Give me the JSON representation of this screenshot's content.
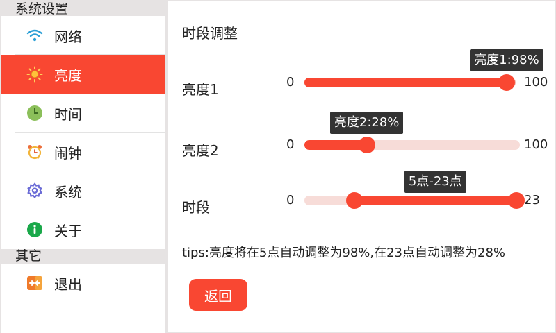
{
  "sidebar": {
    "section_system": "系统设置",
    "section_other": "其它",
    "items": [
      {
        "label": "网络",
        "icon": "wifi-icon"
      },
      {
        "label": "亮度",
        "icon": "sun-icon",
        "active": true
      },
      {
        "label": "时间",
        "icon": "clock-icon"
      },
      {
        "label": "闹钟",
        "icon": "alarm-clock-icon"
      },
      {
        "label": "系统",
        "icon": "gear-icon"
      },
      {
        "label": "关于",
        "icon": "info-icon"
      }
    ],
    "other_items": [
      {
        "label": "退出",
        "icon": "exit-icon"
      }
    ]
  },
  "main": {
    "title": "时段调整",
    "brightness1": {
      "label": "亮度1",
      "min": "0",
      "max": "100",
      "value": 98,
      "tooltip": "亮度1:98%"
    },
    "brightness2": {
      "label": "亮度2",
      "min": "0",
      "max": "100",
      "value": 28,
      "tooltip": "亮度2:28%"
    },
    "period": {
      "label": "时段",
      "min": "0",
      "max": "23",
      "start": 5,
      "end": 23,
      "tooltip": "5点-23点"
    },
    "tips": "tips:亮度将在5点自动调整为98%,在23点自动调整为28%",
    "back_label": "返回"
  },
  "colors": {
    "accent": "#f94732",
    "track": "#f7dcd8",
    "tooltip_bg": "#333333"
  }
}
